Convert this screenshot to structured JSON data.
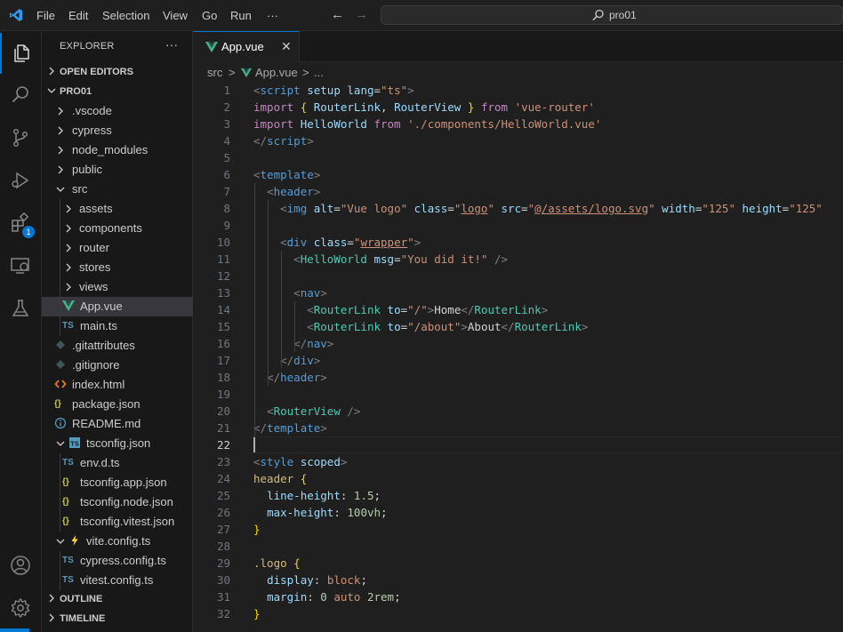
{
  "titlebar": {
    "menu": [
      "File",
      "Edit",
      "Selection",
      "View",
      "Go",
      "Run",
      "···"
    ],
    "search_text": "pro01",
    "accent": "#0078d4"
  },
  "activitybar": {
    "items": [
      "files-icon",
      "search-icon",
      "source-control-icon",
      "run-debug-icon",
      "extensions-icon",
      "remote-explorer-icon",
      "testing-icon"
    ],
    "extensions_badge": "1",
    "bottom_items": [
      "account-icon",
      "settings-gear-icon"
    ]
  },
  "sidebar": {
    "title": "EXPLORER",
    "more": "···",
    "open_editors": "OPEN EDITORS",
    "project": "PRO01",
    "tree": [
      {
        "label": ".vscode",
        "type": "folder"
      },
      {
        "label": "cypress",
        "type": "folder"
      },
      {
        "label": "node_modules",
        "type": "folder"
      },
      {
        "label": "public",
        "type": "folder"
      },
      {
        "label": "src",
        "type": "folder-open"
      },
      {
        "label": "assets",
        "type": "folder"
      },
      {
        "label": "components",
        "type": "folder"
      },
      {
        "label": "router",
        "type": "folder"
      },
      {
        "label": "stores",
        "type": "folder"
      },
      {
        "label": "views",
        "type": "folder"
      },
      {
        "label": "App.vue",
        "type": "vue"
      },
      {
        "label": "main.ts",
        "type": "ts",
        "icon_text": "TS"
      },
      {
        "label": ".gitattributes",
        "type": "git"
      },
      {
        "label": ".gitignore",
        "type": "git"
      },
      {
        "label": "index.html",
        "type": "html"
      },
      {
        "label": "package.json",
        "type": "json",
        "icon_text": "{}"
      },
      {
        "label": "README.md",
        "type": "info"
      },
      {
        "label": "tsconfig.json",
        "type": "tsconfig"
      },
      {
        "label": "env.d.ts",
        "type": "ts",
        "icon_text": "TS"
      },
      {
        "label": "tsconfig.app.json",
        "type": "json",
        "icon_text": "{}"
      },
      {
        "label": "tsconfig.node.json",
        "type": "json",
        "icon_text": "{}"
      },
      {
        "label": "tsconfig.vitest.json",
        "type": "json",
        "icon_text": "{}"
      },
      {
        "label": "vite.config.ts",
        "type": "vite"
      },
      {
        "label": "cypress.config.ts",
        "type": "ts",
        "icon_text": "TS"
      },
      {
        "label": "vitest.config.ts",
        "type": "ts",
        "icon_text": "TS"
      }
    ],
    "outline": "OUTLINE",
    "timeline": "TIMELINE"
  },
  "tabs": [
    {
      "label": "App.vue",
      "close": "✕"
    }
  ],
  "breadcrumbs": {
    "folder": "src",
    "file": "App.vue",
    "sep": ">",
    "more": "..."
  },
  "editor": {
    "line_numbers": [
      "1",
      "2",
      "3",
      "4",
      "5",
      "6",
      "7",
      "8",
      "9",
      "10",
      "11",
      "12",
      "13",
      "14",
      "15",
      "16",
      "17",
      "18",
      "19",
      "20",
      "21",
      "22",
      "23",
      "24",
      "25",
      "26",
      "27",
      "28",
      "29",
      "30",
      "31",
      "32"
    ],
    "active_line": "22",
    "lines": [
      [
        [
          "t-punc",
          "<"
        ],
        [
          "t-tag",
          "script"
        ],
        [
          "t-text",
          " "
        ],
        [
          "t-attr",
          "setup"
        ],
        [
          "t-text",
          " "
        ],
        [
          "t-attr",
          "lang"
        ],
        [
          "t-eq",
          "="
        ],
        [
          "t-str",
          "\"ts\""
        ],
        [
          "t-punc",
          ">"
        ]
      ],
      [
        [
          "t-kw",
          "import"
        ],
        [
          "t-text",
          " "
        ],
        [
          "t-brace",
          "{"
        ],
        [
          "t-text",
          " "
        ],
        [
          "t-var",
          "RouterLink"
        ],
        [
          "t-text",
          ", "
        ],
        [
          "t-var",
          "RouterView"
        ],
        [
          "t-text",
          " "
        ],
        [
          "t-brace",
          "}"
        ],
        [
          "t-text",
          " "
        ],
        [
          "t-kw",
          "from"
        ],
        [
          "t-text",
          " "
        ],
        [
          "t-str",
          "'vue-router'"
        ]
      ],
      [
        [
          "t-kw",
          "import"
        ],
        [
          "t-text",
          " "
        ],
        [
          "t-var",
          "HelloWorld"
        ],
        [
          "t-text",
          " "
        ],
        [
          "t-kw",
          "from"
        ],
        [
          "t-text",
          " "
        ],
        [
          "t-str",
          "'./components/HelloWorld.vue'"
        ]
      ],
      [
        [
          "t-punc",
          "</"
        ],
        [
          "t-tag",
          "script"
        ],
        [
          "t-punc",
          ">"
        ]
      ],
      [],
      [
        [
          "t-punc",
          "<"
        ],
        [
          "t-tag",
          "template"
        ],
        [
          "t-punc",
          ">"
        ]
      ],
      [
        [
          "t-text",
          "  "
        ],
        [
          "t-punc",
          "<"
        ],
        [
          "t-tag",
          "header"
        ],
        [
          "t-punc",
          ">"
        ]
      ],
      [
        [
          "t-text",
          "    "
        ],
        [
          "t-punc",
          "<"
        ],
        [
          "t-tag",
          "img"
        ],
        [
          "t-text",
          " "
        ],
        [
          "t-attr",
          "alt"
        ],
        [
          "t-eq",
          "="
        ],
        [
          "t-str",
          "\"Vue logo\""
        ],
        [
          "t-text",
          " "
        ],
        [
          "t-attr",
          "class"
        ],
        [
          "t-eq",
          "="
        ],
        [
          "t-str",
          "\""
        ],
        [
          "t-str t-ul",
          "logo"
        ],
        [
          "t-str",
          "\""
        ],
        [
          "t-text",
          " "
        ],
        [
          "t-attr",
          "src"
        ],
        [
          "t-eq",
          "="
        ],
        [
          "t-str",
          "\""
        ],
        [
          "t-str t-ul",
          "@/assets/logo.svg"
        ],
        [
          "t-str",
          "\""
        ],
        [
          "t-text",
          " "
        ],
        [
          "t-attr",
          "width"
        ],
        [
          "t-eq",
          "="
        ],
        [
          "t-str",
          "\"125\""
        ],
        [
          "t-text",
          " "
        ],
        [
          "t-attr",
          "height"
        ],
        [
          "t-eq",
          "="
        ],
        [
          "t-str",
          "\"125\""
        ]
      ],
      [],
      [
        [
          "t-text",
          "    "
        ],
        [
          "t-punc",
          "<"
        ],
        [
          "t-tag",
          "div"
        ],
        [
          "t-text",
          " "
        ],
        [
          "t-attr",
          "class"
        ],
        [
          "t-eq",
          "="
        ],
        [
          "t-str",
          "\""
        ],
        [
          "t-str t-ul",
          "wrapper"
        ],
        [
          "t-str",
          "\""
        ],
        [
          "t-punc",
          ">"
        ]
      ],
      [
        [
          "t-text",
          "      "
        ],
        [
          "t-punc",
          "<"
        ],
        [
          "t-comp",
          "HelloWorld"
        ],
        [
          "t-text",
          " "
        ],
        [
          "t-attr",
          "msg"
        ],
        [
          "t-eq",
          "="
        ],
        [
          "t-str",
          "\"You did it!\""
        ],
        [
          "t-text",
          " "
        ],
        [
          "t-punc",
          "/>"
        ]
      ],
      [],
      [
        [
          "t-text",
          "      "
        ],
        [
          "t-punc",
          "<"
        ],
        [
          "t-tag",
          "nav"
        ],
        [
          "t-punc",
          ">"
        ]
      ],
      [
        [
          "t-text",
          "        "
        ],
        [
          "t-punc",
          "<"
        ],
        [
          "t-comp",
          "RouterLink"
        ],
        [
          "t-text",
          " "
        ],
        [
          "t-attr",
          "to"
        ],
        [
          "t-eq",
          "="
        ],
        [
          "t-str",
          "\"/\""
        ],
        [
          "t-punc",
          ">"
        ],
        [
          "t-text",
          "Home"
        ],
        [
          "t-punc",
          "</"
        ],
        [
          "t-comp",
          "RouterLink"
        ],
        [
          "t-punc",
          ">"
        ]
      ],
      [
        [
          "t-text",
          "        "
        ],
        [
          "t-punc",
          "<"
        ],
        [
          "t-comp",
          "RouterLink"
        ],
        [
          "t-text",
          " "
        ],
        [
          "t-attr",
          "to"
        ],
        [
          "t-eq",
          "="
        ],
        [
          "t-str",
          "\"/about\""
        ],
        [
          "t-punc",
          ">"
        ],
        [
          "t-text",
          "About"
        ],
        [
          "t-punc",
          "</"
        ],
        [
          "t-comp",
          "RouterLink"
        ],
        [
          "t-punc",
          ">"
        ]
      ],
      [
        [
          "t-text",
          "      "
        ],
        [
          "t-punc",
          "</"
        ],
        [
          "t-tag",
          "nav"
        ],
        [
          "t-punc",
          ">"
        ]
      ],
      [
        [
          "t-text",
          "    "
        ],
        [
          "t-punc",
          "</"
        ],
        [
          "t-tag",
          "div"
        ],
        [
          "t-punc",
          ">"
        ]
      ],
      [
        [
          "t-text",
          "  "
        ],
        [
          "t-punc",
          "</"
        ],
        [
          "t-tag",
          "header"
        ],
        [
          "t-punc",
          ">"
        ]
      ],
      [],
      [
        [
          "t-text",
          "  "
        ],
        [
          "t-punc",
          "<"
        ],
        [
          "t-comp",
          "RouterView"
        ],
        [
          "t-text",
          " "
        ],
        [
          "t-punc",
          "/>"
        ]
      ],
      [
        [
          "t-punc",
          "</"
        ],
        [
          "t-tag",
          "template"
        ],
        [
          "t-punc",
          ">"
        ]
      ],
      [],
      [
        [
          "t-punc",
          "<"
        ],
        [
          "t-tag",
          "style"
        ],
        [
          "t-text",
          " "
        ],
        [
          "t-attr",
          "scoped"
        ],
        [
          "t-punc",
          ">"
        ]
      ],
      [
        [
          "t-sel",
          "header"
        ],
        [
          "t-text",
          " "
        ],
        [
          "t-brace",
          "{"
        ]
      ],
      [
        [
          "t-text",
          "  "
        ],
        [
          "t-attr",
          "line-height"
        ],
        [
          "t-text",
          ": "
        ],
        [
          "t-num",
          "1.5"
        ],
        [
          "t-text",
          ";"
        ]
      ],
      [
        [
          "t-text",
          "  "
        ],
        [
          "t-attr",
          "max-height"
        ],
        [
          "t-text",
          ": "
        ],
        [
          "t-num",
          "100vh"
        ],
        [
          "t-text",
          ";"
        ]
      ],
      [
        [
          "t-brace",
          "}"
        ]
      ],
      [],
      [
        [
          "t-sel",
          ".logo"
        ],
        [
          "t-text",
          " "
        ],
        [
          "t-brace",
          "{"
        ]
      ],
      [
        [
          "t-text",
          "  "
        ],
        [
          "t-attr",
          "display"
        ],
        [
          "t-text",
          ": "
        ],
        [
          "t-str",
          "block"
        ],
        [
          "t-text",
          ";"
        ]
      ],
      [
        [
          "t-text",
          "  "
        ],
        [
          "t-attr",
          "margin"
        ],
        [
          "t-text",
          ": "
        ],
        [
          "t-num",
          "0"
        ],
        [
          "t-text",
          " "
        ],
        [
          "t-str",
          "auto"
        ],
        [
          "t-text",
          " "
        ],
        [
          "t-num",
          "2rem"
        ],
        [
          "t-text",
          ";"
        ]
      ],
      [
        [
          "t-brace",
          "}"
        ]
      ]
    ]
  }
}
